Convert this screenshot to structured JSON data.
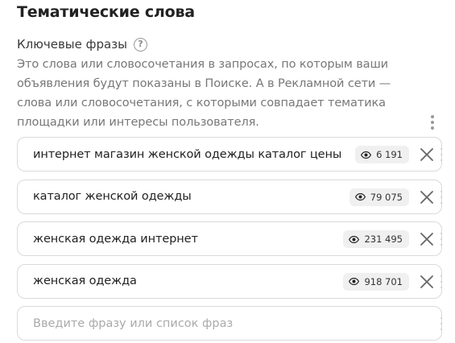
{
  "section": {
    "title": "Тематические слова"
  },
  "keywords": {
    "label": "Ключевые фразы",
    "help_icon": "question-circle-icon",
    "description": "Это слова или словосочетания в запросах, по которым ваши объявления будут показаны в Поиске. А в Рекламной сети — слова или словосочетания, с которыми совпадает тематика площадки или интересы пользователя.",
    "more_icon": "vertical-dots-icon",
    "phrases": [
      {
        "text": "интернет магазин женской одежды каталог цены",
        "impressions": "6 191"
      },
      {
        "text": "каталог женской одежды",
        "impressions": "79 075"
      },
      {
        "text": "женская одежда интернет",
        "impressions": "231 495"
      },
      {
        "text": "женская одежда",
        "impressions": "918 701"
      }
    ],
    "stat_icon": "eye-icon",
    "remove_icon": "close-icon",
    "input": {
      "value": "",
      "placeholder": "Введите фразу или список фраз"
    }
  },
  "colors": {
    "border": "#dadada",
    "badge_bg": "#f0f0f0",
    "muted_text": "#777777"
  }
}
